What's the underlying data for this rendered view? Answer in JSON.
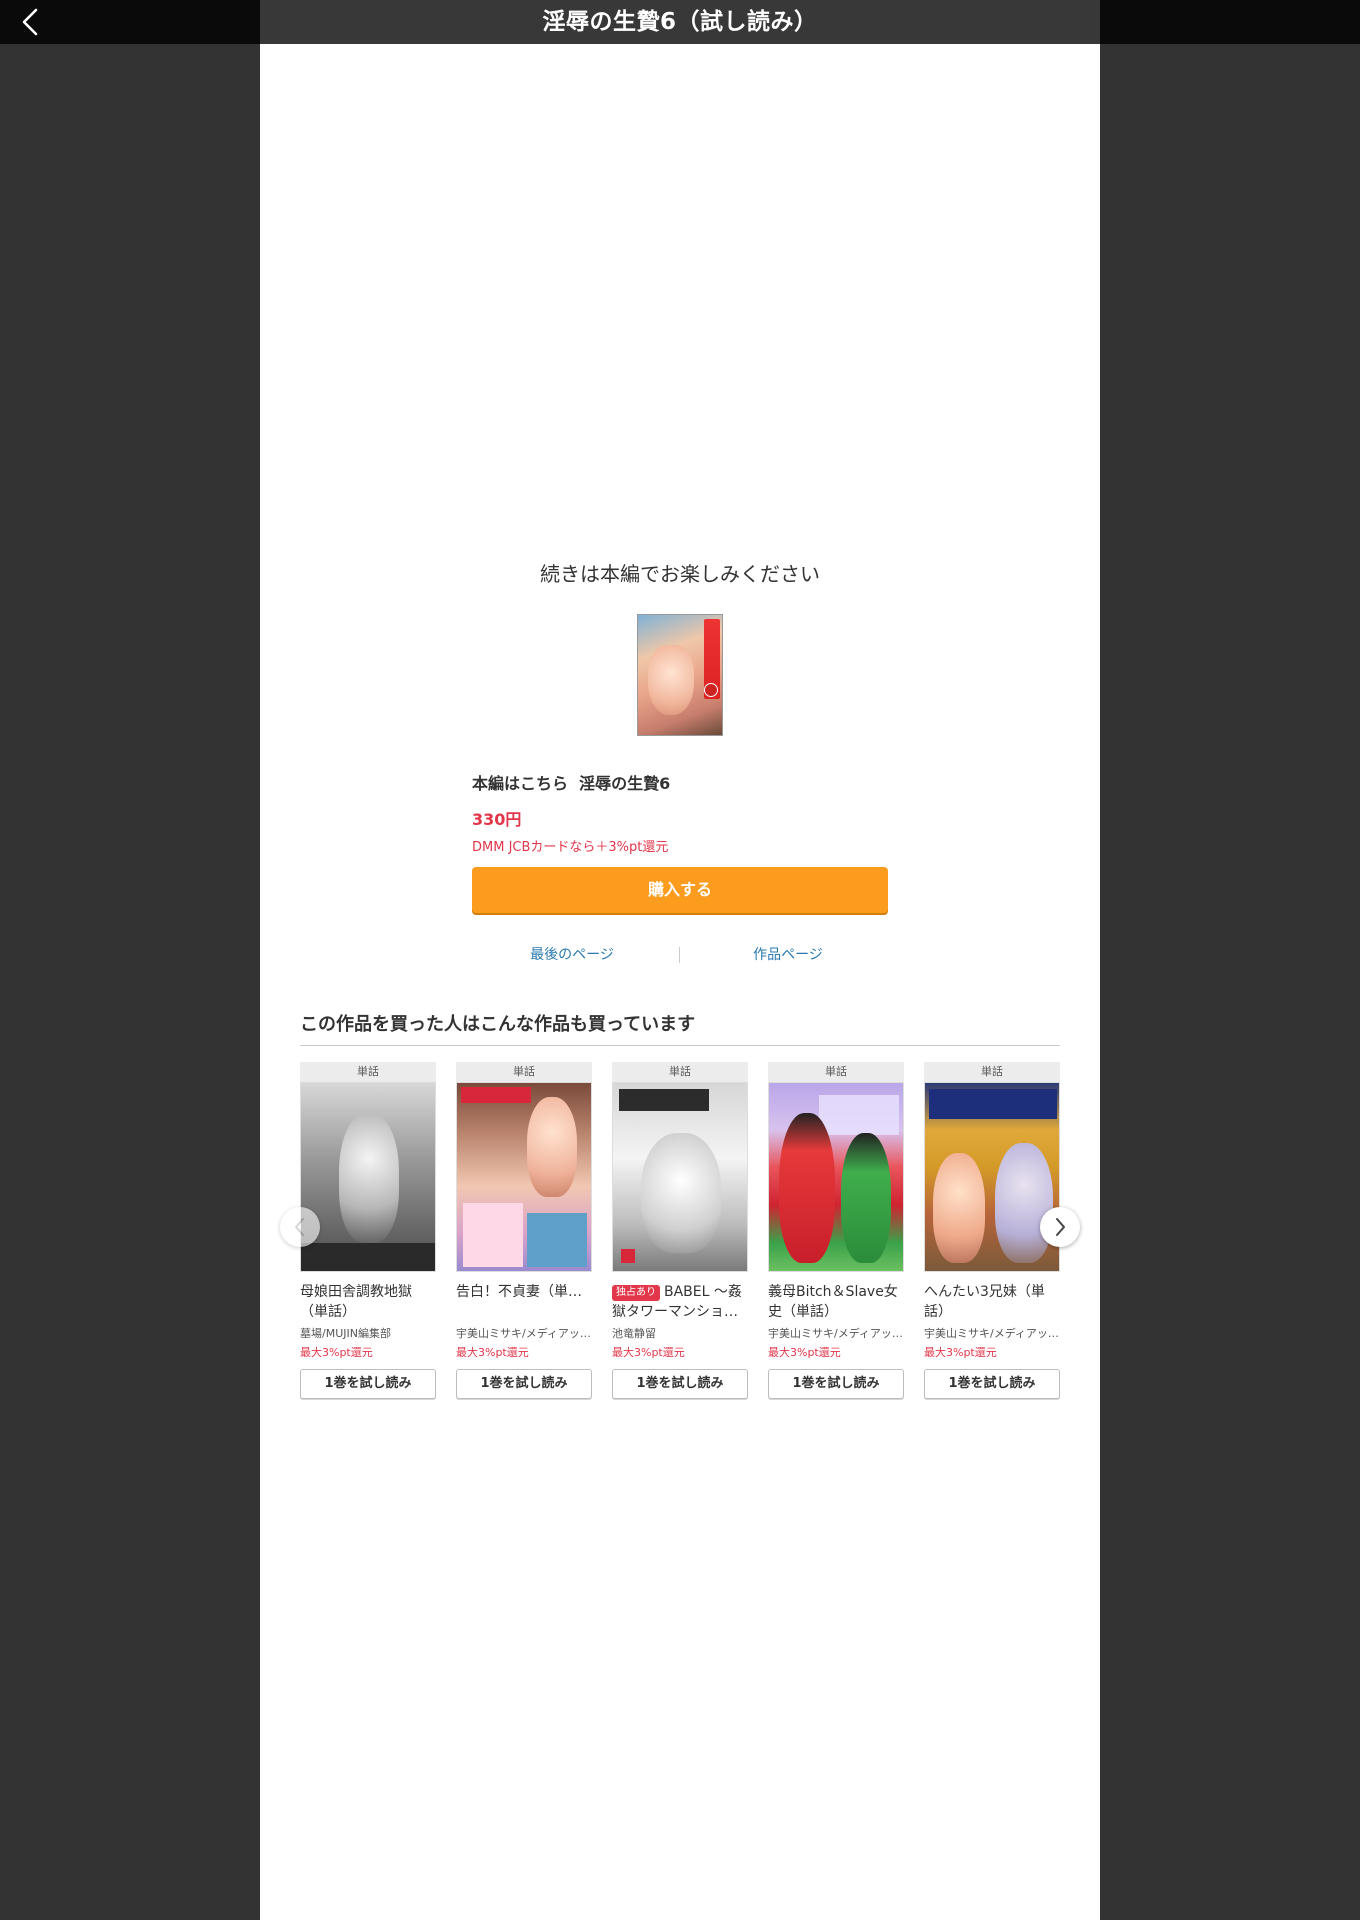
{
  "header": {
    "title": "淫辱の生贄6（試し読み）",
    "back_icon": "chevron-left-icon"
  },
  "end_panel": {
    "message": "続きは本編でお楽しみください",
    "main_link_label": "本編はこちら",
    "main_link_title": "淫辱の生贄6",
    "price": "330円",
    "card_offer": "DMM JCBカードなら＋3%pt還元",
    "buy_button": "購入する",
    "last_page_link": "最後のページ",
    "work_page_link": "作品ページ"
  },
  "recommendations": {
    "heading": "この作品を買った人はこんな作品も買っています",
    "items": [
      {
        "tag": "単話",
        "title": "母娘田舎調教地獄（単話）",
        "exclusive": "",
        "author": "墓場/MUJIN編集部",
        "points": "最大3%pt還元",
        "button": "1巻を試し読み"
      },
      {
        "tag": "単話",
        "title": "告白！不貞妻（単…",
        "exclusive": "",
        "author": "宇美山ミサキ/メディアッ…",
        "points": "最大3%pt還元",
        "button": "1巻を試し読み"
      },
      {
        "tag": "単話",
        "title": "BABEL 〜姦獄タワーマンショ…",
        "exclusive": "独占あり",
        "author": "池竜静留",
        "points": "最大3%pt還元",
        "button": "1巻を試し読み"
      },
      {
        "tag": "単話",
        "title": "義母Bitch＆Slave女史（単話）",
        "exclusive": "",
        "author": "宇美山ミサキ/メディアッ…",
        "points": "最大3%pt還元",
        "button": "1巻を試し読み"
      },
      {
        "tag": "単話",
        "title": "へんたい3兄妹（単話）",
        "exclusive": "",
        "author": "宇美山ミサキ/メディアッ…",
        "points": "最大3%pt還元",
        "button": "1巻を試し読み"
      }
    ],
    "prev_icon": "chevron-left-icon",
    "next_icon": "chevron-right-icon"
  },
  "colors": {
    "accent_orange": "#fb9c1f",
    "price_red": "#e2364b",
    "link_blue": "#2a7ab0",
    "background": "#333333"
  }
}
